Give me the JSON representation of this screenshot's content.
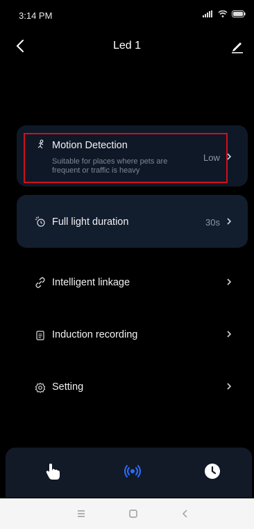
{
  "status": {
    "time": "3:14 PM"
  },
  "header": {
    "title": "Led 1"
  },
  "motion": {
    "title": "Motion Detection",
    "subtitle": "Suitable for places where pets are frequent or traffic is heavy",
    "value": "Low"
  },
  "full_light": {
    "title": "Full light duration",
    "value": "30s"
  },
  "menu": [
    {
      "label": "Intelligent linkage"
    },
    {
      "label": "Induction recording"
    },
    {
      "label": "Setting"
    }
  ],
  "colors": {
    "accent_blue": "#2b6cff",
    "highlight_red": "#d0101b"
  },
  "bottom_nav": {
    "items": [
      "hand-icon",
      "radar-icon",
      "clock-icon"
    ],
    "active": "radar-icon"
  }
}
